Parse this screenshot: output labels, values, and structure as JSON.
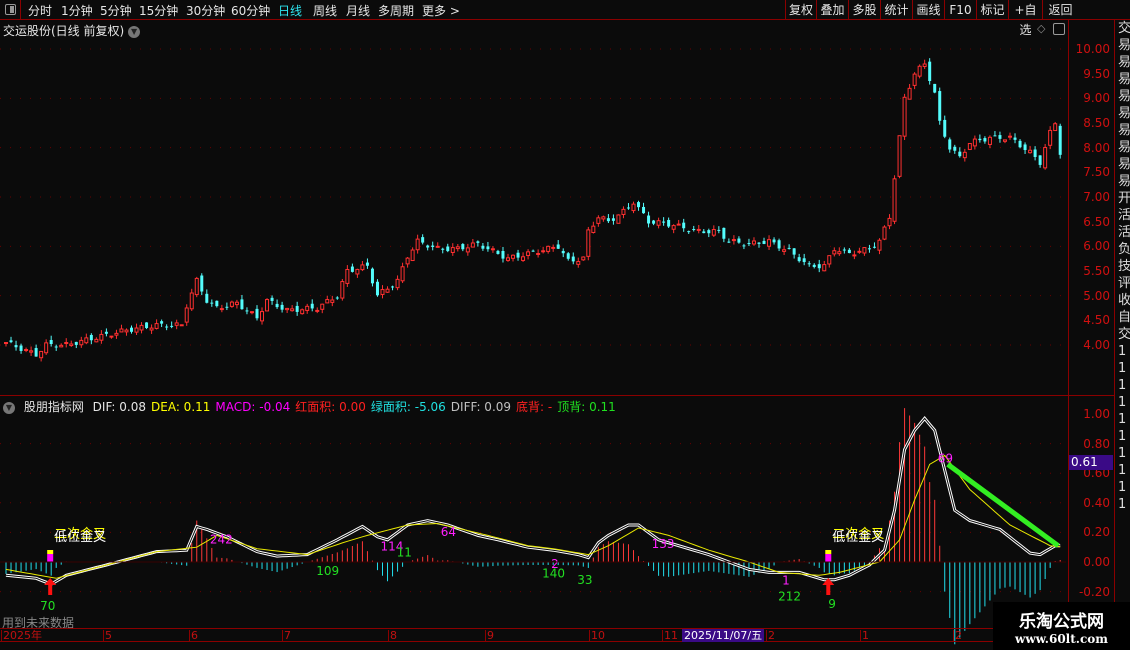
{
  "toolbar": {
    "periods": [
      "分时",
      "1分钟",
      "5分钟",
      "15分钟",
      "30分钟",
      "60分钟",
      "日线",
      "周线",
      "月线",
      "多周期",
      "更多 >"
    ],
    "active": "日线",
    "buttons": [
      "复权",
      "叠加",
      "多股",
      "统计",
      "画线",
      "F10",
      "标记",
      "+自选",
      "返回"
    ]
  },
  "title": "交运股份(日线 前复权)",
  "indicator": {
    "name": "股朋指标网",
    "values": [
      {
        "label": "DIF: 0.08",
        "color": "#e6e6e6"
      },
      {
        "label": "DEA: 0.11",
        "color": "#ffff00"
      },
      {
        "label": "MACD: -0.04",
        "color": "#ff00ff"
      },
      {
        "label": "红面积: 0.00",
        "color": "#ff2020"
      },
      {
        "label": "绿面积: -5.06",
        "color": "#20e0e0"
      },
      {
        "label": "DIFF: 0.09",
        "color": "#c0c0c0"
      },
      {
        "label": "底背: -",
        "color": "#ff2020"
      },
      {
        "label": "顶背: 0.11",
        "color": "#20e020"
      }
    ],
    "current_value": "0.61"
  },
  "price_axis": [
    "10.00",
    "9.50",
    "9.00",
    "8.50",
    "8.00",
    "7.50",
    "7.00",
    "6.50",
    "6.00",
    "5.50",
    "5.00",
    "4.50",
    "4.00"
  ],
  "macd_axis": [
    "1.00",
    "0.80",
    "0.60",
    "0.40",
    "0.20",
    "0.00",
    "-0.20"
  ],
  "time_axis": {
    "labels": [
      "2025年",
      "5",
      "6",
      "7",
      "8",
      "9",
      "10",
      "11",
      "2",
      "1",
      "2"
    ],
    "highlight": "2025/11/07/五"
  },
  "future_note": "用到未来数据",
  "watermark": {
    "name": "乐淘公式网",
    "url": "www.60lt.com"
  },
  "right_strip": [
    "交",
    "易",
    "易",
    "易",
    "易",
    "易",
    "易",
    "易",
    "易",
    "易",
    "开",
    "活",
    "活",
    "负",
    "技",
    "评",
    "收",
    "自",
    "交",
    "1",
    "1",
    "1",
    "1",
    "1",
    "1",
    "1",
    "1",
    "1",
    "1"
  ],
  "chart_data": {
    "type": "candlestick+macd",
    "price_keypoints": [
      [
        0,
        4.05
      ],
      [
        6,
        3.8
      ],
      [
        8,
        4.0
      ],
      [
        12,
        4.0
      ],
      [
        18,
        4.15
      ],
      [
        24,
        4.3
      ],
      [
        30,
        4.4
      ],
      [
        35,
        4.4
      ],
      [
        36,
        4.8
      ],
      [
        38,
        5.3
      ],
      [
        40,
        4.9
      ],
      [
        42,
        4.75
      ],
      [
        46,
        4.85
      ],
      [
        50,
        4.55
      ],
      [
        52,
        4.9
      ],
      [
        56,
        4.7
      ],
      [
        62,
        4.75
      ],
      [
        66,
        5.0
      ],
      [
        68,
        5.5
      ],
      [
        72,
        5.6
      ],
      [
        74,
        5.0
      ],
      [
        78,
        5.3
      ],
      [
        80,
        5.8
      ],
      [
        82,
        6.1
      ],
      [
        86,
        5.95
      ],
      [
        90,
        5.95
      ],
      [
        94,
        6.05
      ],
      [
        100,
        5.75
      ],
      [
        106,
        5.9
      ],
      [
        110,
        6.0
      ],
      [
        112,
        5.7
      ],
      [
        115,
        5.75
      ],
      [
        116,
        6.3
      ],
      [
        118,
        6.6
      ],
      [
        120,
        6.5
      ],
      [
        123,
        6.7
      ],
      [
        125,
        6.9
      ],
      [
        128,
        6.5
      ],
      [
        132,
        6.45
      ],
      [
        138,
        6.3
      ],
      [
        142,
        6.3
      ],
      [
        144,
        6.1
      ],
      [
        148,
        6.05
      ],
      [
        152,
        6.1
      ],
      [
        156,
        5.9
      ],
      [
        160,
        5.6
      ],
      [
        163,
        5.6
      ],
      [
        165,
        5.95
      ],
      [
        168,
        5.85
      ],
      [
        172,
        5.95
      ],
      [
        174,
        6.1
      ],
      [
        176,
        6.6
      ],
      [
        177,
        7.4
      ],
      [
        178,
        8.2
      ],
      [
        179,
        9.0
      ],
      [
        181,
        9.5
      ],
      [
        183,
        9.7
      ],
      [
        185,
        9.1
      ],
      [
        186,
        8.5
      ],
      [
        188,
        8.0
      ],
      [
        190,
        7.8
      ],
      [
        192,
        8.1
      ],
      [
        196,
        8.2
      ],
      [
        200,
        8.2
      ],
      [
        204,
        7.9
      ],
      [
        206,
        7.7
      ],
      [
        208,
        8.3
      ],
      [
        209,
        8.5
      ],
      [
        210,
        7.9
      ]
    ],
    "dif_keypoints": [
      [
        0,
        -0.09
      ],
      [
        6,
        -0.11
      ],
      [
        9,
        -0.15
      ],
      [
        12,
        -0.09
      ],
      [
        20,
        -0.02
      ],
      [
        30,
        0.07
      ],
      [
        36,
        0.08
      ],
      [
        38,
        0.24
      ],
      [
        40,
        0.22
      ],
      [
        44,
        0.17
      ],
      [
        50,
        0.07
      ],
      [
        54,
        0.04
      ],
      [
        60,
        0.05
      ],
      [
        66,
        0.15
      ],
      [
        71,
        0.24
      ],
      [
        74,
        0.17
      ],
      [
        76,
        0.15
      ],
      [
        80,
        0.25
      ],
      [
        84,
        0.28
      ],
      [
        88,
        0.25
      ],
      [
        94,
        0.18
      ],
      [
        98,
        0.15
      ],
      [
        104,
        0.1
      ],
      [
        109,
        0.08
      ],
      [
        114,
        0.05
      ],
      [
        116,
        0.03
      ],
      [
        118,
        0.13
      ],
      [
        120,
        0.18
      ],
      [
        124,
        0.25
      ],
      [
        126,
        0.25
      ],
      [
        130,
        0.15
      ],
      [
        140,
        0.05
      ],
      [
        148,
        -0.05
      ],
      [
        152,
        -0.07
      ],
      [
        158,
        -0.07
      ],
      [
        163,
        -0.12
      ],
      [
        165,
        -0.12
      ],
      [
        168,
        -0.09
      ],
      [
        172,
        -0.02
      ],
      [
        175,
        0.08
      ],
      [
        177,
        0.35
      ],
      [
        179,
        0.76
      ],
      [
        181,
        0.89
      ],
      [
        183,
        0.97
      ],
      [
        185,
        0.89
      ],
      [
        187,
        0.62
      ],
      [
        189,
        0.35
      ],
      [
        192,
        0.28
      ],
      [
        198,
        0.22
      ],
      [
        204,
        0.06
      ],
      [
        206,
        0.05
      ],
      [
        209,
        0.11
      ]
    ],
    "dea_keypoints": [
      [
        0,
        -0.05
      ],
      [
        10,
        -0.11
      ],
      [
        20,
        -0.02
      ],
      [
        30,
        0.07
      ],
      [
        38,
        0.1
      ],
      [
        42,
        0.18
      ],
      [
        50,
        0.09
      ],
      [
        60,
        0.05
      ],
      [
        68,
        0.14
      ],
      [
        72,
        0.18
      ],
      [
        80,
        0.25
      ],
      [
        86,
        0.26
      ],
      [
        96,
        0.18
      ],
      [
        104,
        0.11
      ],
      [
        109,
        0.09
      ],
      [
        116,
        0.05
      ],
      [
        120,
        0.11
      ],
      [
        126,
        0.23
      ],
      [
        132,
        0.18
      ],
      [
        140,
        0.08
      ],
      [
        148,
        0.0
      ],
      [
        154,
        -0.07
      ],
      [
        162,
        -0.09
      ],
      [
        166,
        -0.07
      ],
      [
        174,
        0.0
      ],
      [
        178,
        0.15
      ],
      [
        181,
        0.42
      ],
      [
        184,
        0.66
      ],
      [
        187,
        0.72
      ],
      [
        192,
        0.49
      ],
      [
        200,
        0.25
      ],
      [
        208,
        0.11
      ],
      [
        211,
        0.1
      ]
    ],
    "divergence_line": {
      "from": [
        188,
        0.66
      ],
      "to": [
        210,
        0.11
      ],
      "color": "#33ee22"
    },
    "signals": {
      "magenta_labels": [
        [
          41,
          "242"
        ],
        [
          75,
          "114"
        ],
        [
          87,
          "64"
        ],
        [
          109,
          "2"
        ],
        [
          129,
          "133"
        ],
        [
          155,
          "1"
        ],
        [
          186,
          "69"
        ]
      ],
      "green_labels": [
        [
          8,
          "70"
        ],
        [
          63,
          "109"
        ],
        [
          79,
          "11"
        ],
        [
          108,
          "140"
        ],
        [
          115,
          "33"
        ],
        [
          155,
          "212"
        ],
        [
          165,
          "9"
        ]
      ],
      "cross_text": [
        "二次金叉",
        "低位金叉"
      ],
      "cross_bars": [
        9,
        164
      ]
    },
    "ylim_price": [
      3.4,
      10.4
    ],
    "ylim_macd": [
      -0.25,
      1.1
    ]
  }
}
